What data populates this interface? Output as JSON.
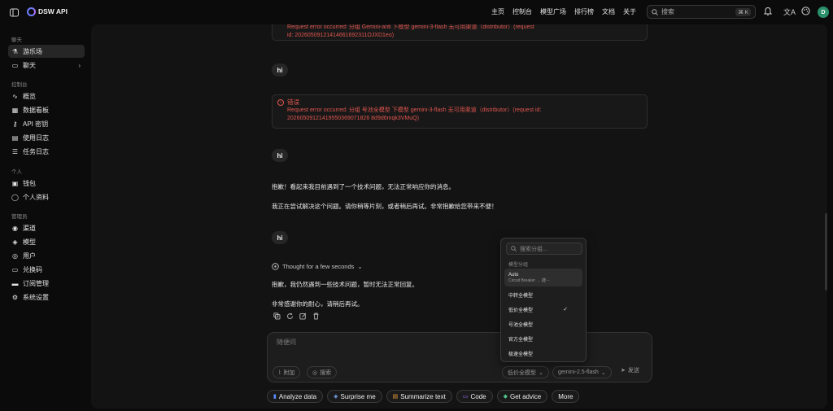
{
  "app": {
    "brand": "DSW API",
    "avatar_letter": "D"
  },
  "topnav": [
    "主页",
    "控制台",
    "模型广场",
    "排行榜",
    "文档",
    "关于"
  ],
  "search": {
    "placeholder": "搜索",
    "shortcut": "⌘ K"
  },
  "sidebar": {
    "sections": {
      "chat": "聊天",
      "console": "控制台",
      "personal": "个人",
      "admin": "管理员"
    },
    "items": [
      {
        "label": "游乐场",
        "icon": "flask-icon",
        "glyph": "⚗"
      },
      {
        "label": "聊天",
        "icon": "chat-icon",
        "glyph": "▭"
      },
      {
        "label": "概览",
        "icon": "activity-icon",
        "glyph": "∿"
      },
      {
        "label": "数据看板",
        "icon": "grid-icon",
        "glyph": "▦"
      },
      {
        "label": "API 密钥",
        "icon": "key-icon",
        "glyph": "⚷"
      },
      {
        "label": "使用日志",
        "icon": "file-icon",
        "glyph": "▤"
      },
      {
        "label": "任务日志",
        "icon": "list-icon",
        "glyph": "☰"
      },
      {
        "label": "钱包",
        "icon": "wallet-icon",
        "glyph": "▣"
      },
      {
        "label": "个人资料",
        "icon": "user-icon",
        "glyph": "◯"
      },
      {
        "label": "渠道",
        "icon": "radio-icon",
        "glyph": "◉"
      },
      {
        "label": "模型",
        "icon": "box-icon",
        "glyph": "◈"
      },
      {
        "label": "用户",
        "icon": "users-icon",
        "glyph": "◎"
      },
      {
        "label": "兑换码",
        "icon": "ticket-icon",
        "glyph": "▭"
      },
      {
        "label": "订阅管理",
        "icon": "card-icon",
        "glyph": "▬"
      },
      {
        "label": "系统设置",
        "icon": "gear-icon",
        "glyph": "⚙"
      }
    ]
  },
  "chat": {
    "error1": {
      "line1": "Request error occurred: 分组 Gemini-anti 下模型 gemini-3-flash 无可用渠道（distributor）(request",
      "line2": "id: 20260509121414661692311OJXD1eo)"
    },
    "user1": "hi",
    "error2": {
      "title": "错误",
      "line1": "Request error occurred: 分组 号池全模型 下模型 gemini-3-flash 无可用渠道（distributor）(request id:",
      "line2": "20260509121419550369071826 8d9d6mqk3VMuQ)"
    },
    "user2": "hi",
    "reply1": {
      "line1": "抱歉！看起来我目前遇到了一个技术问题，无法正常响应你的消息。",
      "line2": "我正在尝试解决这个问题。请你稍等片刻，或者稍后再试。非常抱歉给您带来不便！"
    },
    "user3": "hi",
    "thought": "Thought for a few seconds",
    "reply2": {
      "line1": "抱歉，我仍然遇到一些技术问题，暂时无法正常回复。",
      "line2": "非常感谢你的耐心，请稍后再试。"
    }
  },
  "input": {
    "placeholder": "随便问",
    "attach": "附加",
    "search": "搜索",
    "group": "低价全模型",
    "model": "gemini-2.5-flash",
    "send": "发送"
  },
  "dropdown": {
    "search_placeholder": "搜索分组...",
    "label": "模型分组",
    "auto_title": "Auto",
    "auto_sub": "Circuit Breaker → 捷···",
    "options": [
      "中转全模型",
      "低价全模型",
      "号池全模型",
      "官方全模型",
      "极速全模型"
    ],
    "selected": "低价全模型"
  },
  "chips": [
    {
      "label": "Analyze data",
      "icon": "chart-icon",
      "glyph": "▮",
      "color": "#5b8cff"
    },
    {
      "label": "Surprise me",
      "icon": "cube-icon",
      "glyph": "◈",
      "color": "#7fb0ff"
    },
    {
      "label": "Summarize text",
      "icon": "doc-icon",
      "glyph": "▤",
      "color": "#f0a040"
    },
    {
      "label": "Code",
      "icon": "code-icon",
      "glyph": "▭",
      "color": "#a070ff"
    },
    {
      "label": "Get advice",
      "icon": "grad-icon",
      "glyph": "◆",
      "color": "#4cc38a"
    },
    {
      "label": "More",
      "icon": "",
      "glyph": "",
      "color": "#f0f0f0"
    }
  ],
  "colors": {
    "error": "#e0564f",
    "accent": "#6f7cff",
    "avatar": "#2a8f6a"
  }
}
